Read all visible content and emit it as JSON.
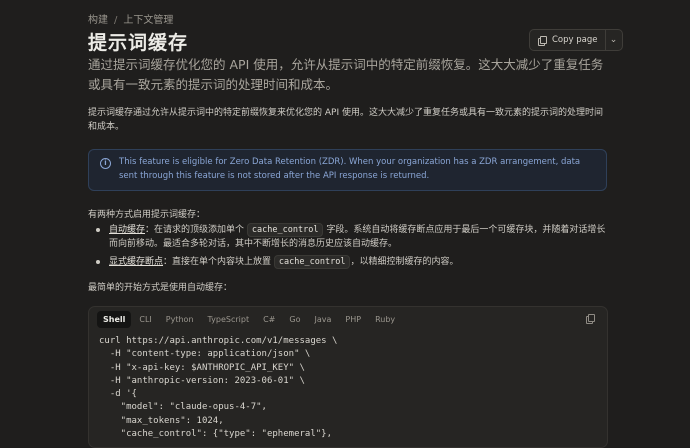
{
  "breadcrumb": {
    "parent": "构建",
    "current": "上下文管理"
  },
  "page": {
    "title": "提示词缓存",
    "lead": "通过提示词缓存优化您的 API 使用，允许从提示词中的特定前缀恢复。这大大减少了重复任务或具有一致元素的提示词的处理时间和成本。",
    "intro": "提示词缓存通过允许从提示词中的特定前缀恢复来优化您的 API 使用。这大大减少了重复任务或具有一致元素的提示词的处理时间和成本。"
  },
  "copy_page": {
    "label": "Copy page",
    "icon": "copy-icon",
    "menu_icon": "chevron-down-icon"
  },
  "note": {
    "icon": "info-icon",
    "text": "This feature is eligible for Zero Data Retention (ZDR). When your organization has a ZDR arrangement, data sent through this feature is not stored after the API response is returned."
  },
  "ways_intro": "有两种方式启用提示词缓存：",
  "bullets": [
    {
      "term": "自动缓存",
      "pre": "：在请求的顶级添加单个",
      "code": "cache_control",
      "post": "字段。系统自动将缓存断点应用于最后一个可缓存块，并随着对话增长而向前移动。最适合多轮对话，其中不断增长的消息历史应该自动缓存。"
    },
    {
      "term": "显式缓存断点",
      "pre": "：直接在单个内容块上放置",
      "code": "cache_control",
      "post": "，以精细控制缓存的内容。"
    }
  ],
  "start_text": "最简单的开始方式是使用自动缓存：",
  "code_tabs": [
    "Shell",
    "CLI",
    "Python",
    "TypeScript",
    "C#",
    "Go",
    "Java",
    "PHP",
    "Ruby"
  ],
  "active_tab": "Shell",
  "code_lines": [
    "curl https://api.anthropic.com/v1/messages \\",
    "  -H \"content-type: application/json\" \\",
    "  -H \"x-api-key: $ANTHROPIC_API_KEY\" \\",
    "  -H \"anthropic-version: 2023-06-01\" \\",
    "  -d '{",
    "    \"model\": \"claude-opus-4-7\",",
    "    \"max_tokens\": 1024,",
    "    \"cache_control\": {\"type\": \"ephemeral\"},"
  ]
}
